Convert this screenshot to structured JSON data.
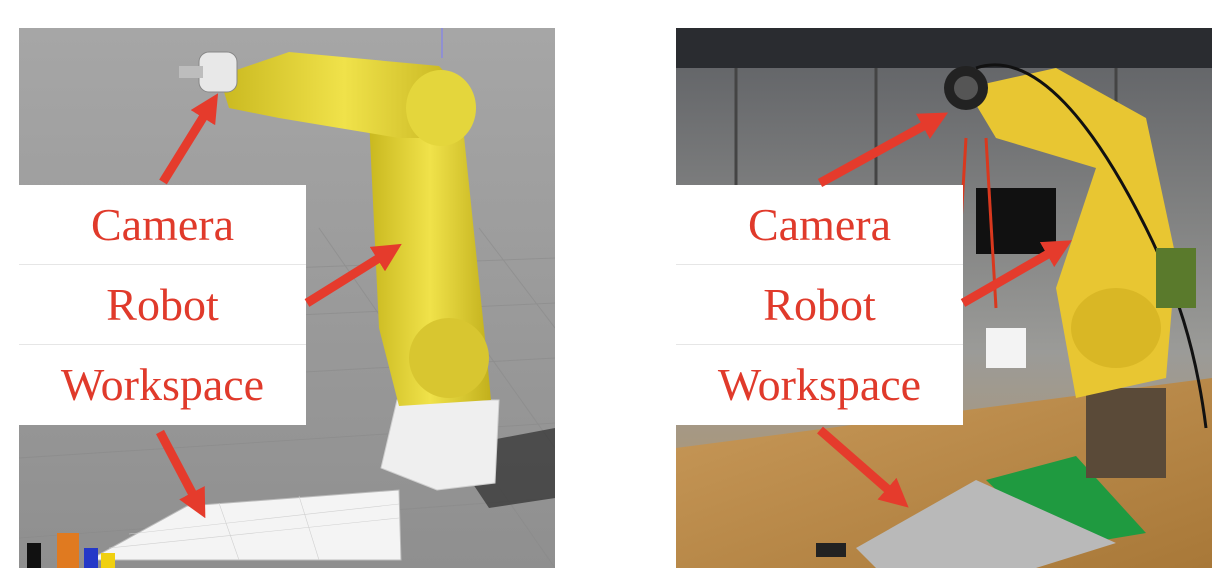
{
  "left_panel": {
    "labels": [
      "Camera",
      "Robot",
      "Workspace"
    ]
  },
  "right_panel": {
    "labels": [
      "Camera",
      "Robot",
      "Workspace"
    ]
  },
  "colors": {
    "label_text": "#e03a2b",
    "arrow": "#e53b2c",
    "robot_yellow": "#e6d43a",
    "sim_background": "#9c9c9c"
  }
}
